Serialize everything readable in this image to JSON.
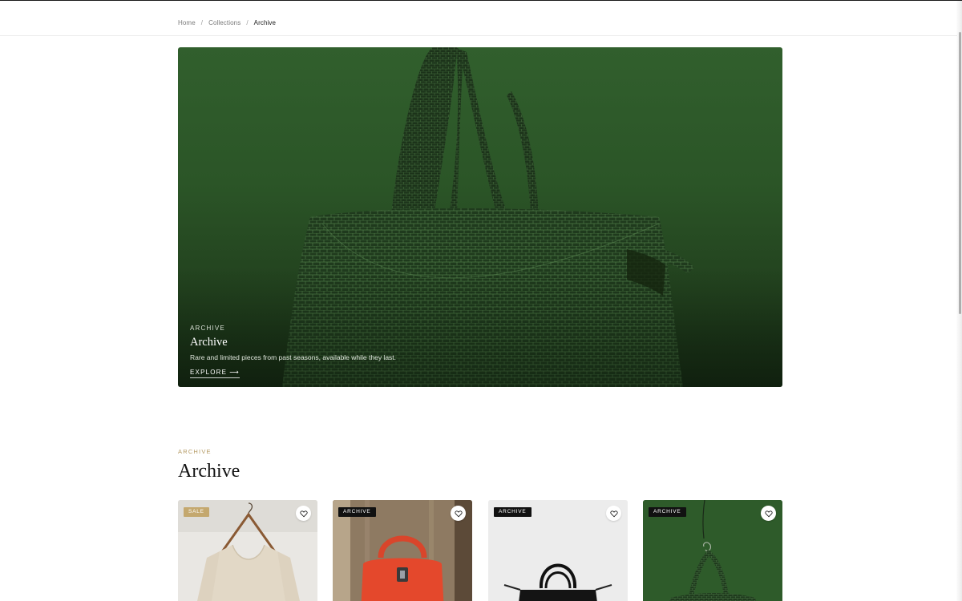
{
  "breadcrumb": {
    "items": [
      "Home",
      "Collections"
    ],
    "separator": "/",
    "current": "Archive"
  },
  "hero": {
    "kicker": "ARCHIVE",
    "title": "Archive",
    "description": "Rare and limited pieces from past seasons, available while they last.",
    "cta_label": "EXPLORE",
    "cta_arrow": "⟶",
    "image": "green croc-embossed tote bag",
    "background_color": "#2d5a29"
  },
  "section": {
    "kicker": "ARCHIVE",
    "title": "Archive"
  },
  "products": [
    {
      "badge": "SALE",
      "badge_style": "sale",
      "image": "cream knit sweater on hanger",
      "favorite_icon": "heart-icon"
    },
    {
      "badge": "ARCHIVE",
      "badge_style": "archive",
      "image": "red leather top-handle bag",
      "favorite_icon": "heart-icon"
    },
    {
      "badge": "ARCHIVE",
      "badge_style": "archive",
      "image": "black tote bag on white",
      "favorite_icon": "heart-icon"
    },
    {
      "badge": "ARCHIVE",
      "badge_style": "archive",
      "image": "green croc tote bag",
      "favorite_icon": "heart-icon"
    }
  ],
  "colors": {
    "accent_gold": "#b49a63",
    "sale_badge": "#c4a86e",
    "archive_badge": "#111111"
  }
}
